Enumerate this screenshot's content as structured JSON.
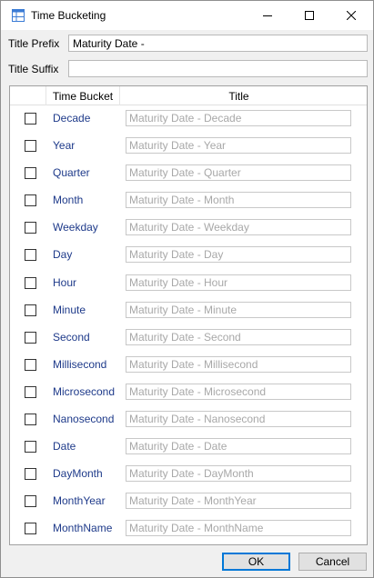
{
  "window": {
    "title": "Time Bucketing",
    "icon": "grid-table-icon",
    "controls": {
      "minimize": "minimize-icon",
      "maximize": "maximize-icon",
      "close": "close-icon"
    }
  },
  "form": {
    "prefix_label": "Title Prefix",
    "prefix_value": "Maturity Date -",
    "suffix_label": "Title Suffix",
    "suffix_value": ""
  },
  "grid": {
    "columns": [
      "Time Bucket",
      "Title"
    ],
    "rows": [
      {
        "bucket": "Decade",
        "title": "Maturity Date - Decade",
        "checked": false
      },
      {
        "bucket": "Year",
        "title": "Maturity Date - Year",
        "checked": false
      },
      {
        "bucket": "Quarter",
        "title": "Maturity Date - Quarter",
        "checked": false
      },
      {
        "bucket": "Month",
        "title": "Maturity Date - Month",
        "checked": false
      },
      {
        "bucket": "Weekday",
        "title": "Maturity Date - Weekday",
        "checked": false
      },
      {
        "bucket": "Day",
        "title": "Maturity Date - Day",
        "checked": false
      },
      {
        "bucket": "Hour",
        "title": "Maturity Date - Hour",
        "checked": false
      },
      {
        "bucket": "Minute",
        "title": "Maturity Date - Minute",
        "checked": false
      },
      {
        "bucket": "Second",
        "title": "Maturity Date - Second",
        "checked": false
      },
      {
        "bucket": "Millisecond",
        "title": "Maturity Date - Millisecond",
        "checked": false
      },
      {
        "bucket": "Microsecond",
        "title": "Maturity Date - Microsecond",
        "checked": false
      },
      {
        "bucket": "Nanosecond",
        "title": "Maturity Date - Nanosecond",
        "checked": false
      },
      {
        "bucket": "Date",
        "title": "Maturity Date - Date",
        "checked": false
      },
      {
        "bucket": "DayMonth",
        "title": "Maturity Date - DayMonth",
        "checked": false
      },
      {
        "bucket": "MonthYear",
        "title": "Maturity Date - MonthYear",
        "checked": false
      },
      {
        "bucket": "MonthName",
        "title": "Maturity Date - MonthName",
        "checked": false
      }
    ]
  },
  "buttons": {
    "ok": "OK",
    "cancel": "Cancel"
  },
  "colors": {
    "bucket_text": "#1e3a8a",
    "placeholder_text": "#a8a8a8",
    "default_button_border": "#0078d7"
  }
}
